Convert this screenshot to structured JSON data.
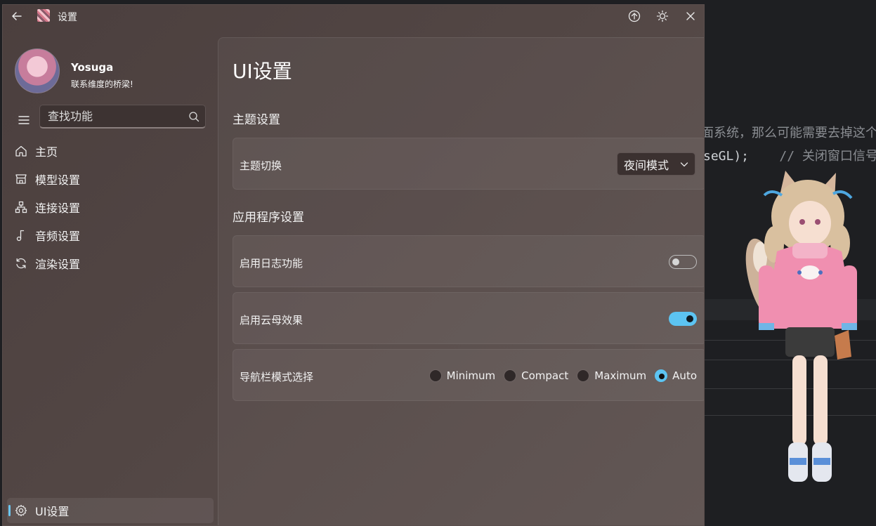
{
  "window": {
    "title": "设置",
    "back_icon": "back-arrow-icon",
    "actions": [
      "pin-icon",
      "theme-icon",
      "close-icon"
    ]
  },
  "background": {
    "code_line_1": "面系统，那么可能需要去掉这个",
    "code_line_2_code": "seGL);",
    "code_line_2_comment": "// 关闭窗口信号"
  },
  "user": {
    "name": "Yosuga",
    "motto": "联系维度的桥梁!"
  },
  "search": {
    "placeholder": "查找功能"
  },
  "nav": {
    "items": [
      {
        "label": "主页",
        "icon": "home-icon"
      },
      {
        "label": "模型设置",
        "icon": "model-icon"
      },
      {
        "label": "连接设置",
        "icon": "connection-icon"
      },
      {
        "label": "音频设置",
        "icon": "music-icon"
      },
      {
        "label": "渲染设置",
        "icon": "refresh-icon"
      }
    ],
    "footer": {
      "label": "UI设置",
      "icon": "gear-icon",
      "selected": true
    }
  },
  "page": {
    "title": "UI设置",
    "sections": {
      "theme": {
        "title": "主题设置",
        "switch_label": "主题切换",
        "switch_value": "夜间模式"
      },
      "app": {
        "title": "应用程序设置",
        "log_label": "启用日志功能",
        "log_enabled": false,
        "mica_label": "启用云母效果",
        "mica_enabled": true,
        "nav_mode_label": "导航栏模式选择",
        "nav_mode_options": [
          "Minimum",
          "Compact",
          "Maximum",
          "Auto"
        ],
        "nav_mode_selected": "Auto"
      }
    }
  },
  "colors": {
    "accent": "#5cc4f2",
    "window_bg": "#4e4241"
  }
}
